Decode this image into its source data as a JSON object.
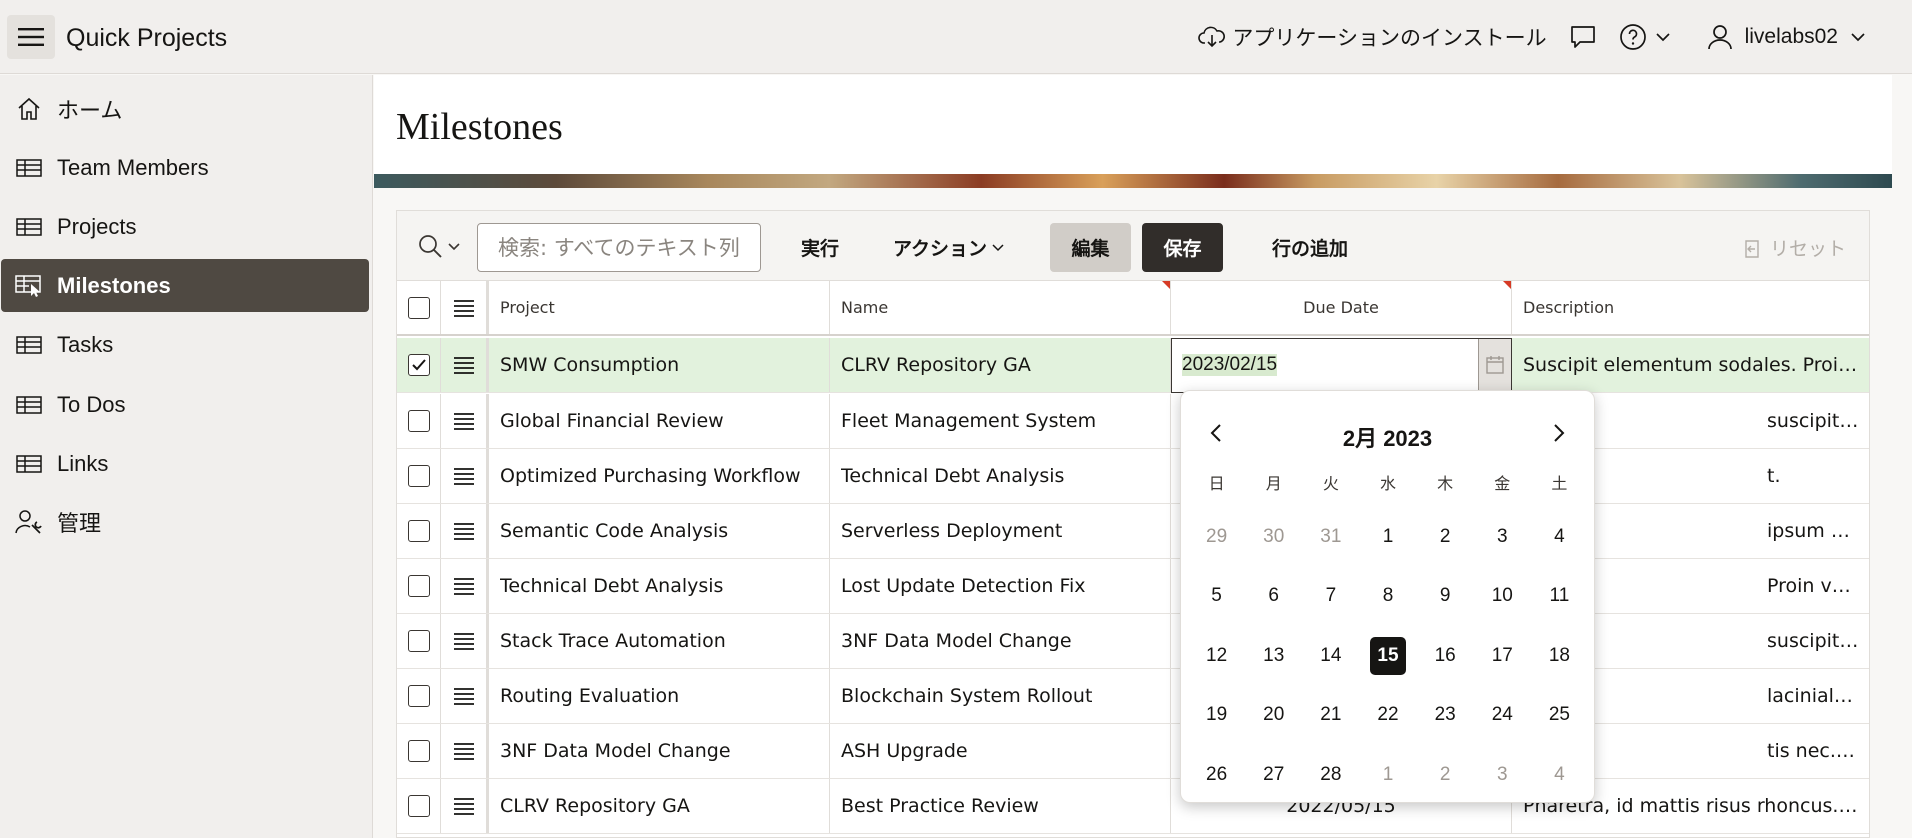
{
  "app": {
    "title": "Quick Projects"
  },
  "header": {
    "install_label": "アプリケーションのインストール",
    "user_name": "livelabs02"
  },
  "sidebar": {
    "items": [
      {
        "label": "ホーム",
        "icon": "home-icon"
      },
      {
        "label": "Team Members",
        "icon": "table-icon"
      },
      {
        "label": "Projects",
        "icon": "table-icon"
      },
      {
        "label": "Milestones",
        "icon": "table-pointer-icon",
        "active": true
      },
      {
        "label": "Tasks",
        "icon": "table-icon"
      },
      {
        "label": "To Dos",
        "icon": "table-icon"
      },
      {
        "label": "Links",
        "icon": "table-icon"
      },
      {
        "label": "管理",
        "icon": "user-wrench-icon"
      }
    ]
  },
  "page": {
    "title": "Milestones"
  },
  "toolbar": {
    "search_placeholder": "検索: すべてのテキスト列",
    "run_label": "実行",
    "actions_label": "アクション",
    "edit_label": "編集",
    "save_label": "保存",
    "add_row_label": "行の追加",
    "reset_label": "リセット"
  },
  "grid": {
    "columns": {
      "project": "Project",
      "name": "Name",
      "due_date": "Due Date",
      "description": "Description"
    },
    "rows": [
      {
        "project": "SMW Consumption",
        "name": "CLRV Repository GA",
        "due": "2023/02/15",
        "description": "Suscipit elementum sodales. Proin s…",
        "selected": true
      },
      {
        "project": "Global Financial Review",
        "name": "Fleet Management System",
        "due": "",
        "description": "suscipit tristique ac volutpat …"
      },
      {
        "project": "Optimized Purchasing Workflow",
        "name": "Technical Debt Analysis",
        "due": "",
        "description": "t."
      },
      {
        "project": "Semantic Code Analysis",
        "name": "Serverless Deployment",
        "due": "",
        "description": "ipsum primis in faucibus. U…"
      },
      {
        "project": "Technical Debt Analysis",
        "name": "Lost Update Detection Fix",
        "due": "",
        "description": "Proin vulputate placerat pell…"
      },
      {
        "project": "Stack Trace Automation",
        "name": "3NF Data Model Change",
        "due": "",
        "description": "suscipit tristique ac volutpat …"
      },
      {
        "project": "Routing Evaluation",
        "name": "Blockchain System Rollout",
        "due": "",
        "description": "lacinialectus, quis consectet…"
      },
      {
        "project": "3NF Data Model Change",
        "name": "ASH Upgrade",
        "due": "",
        "description": "tis nec. Donec convallis solli…"
      },
      {
        "project": "CLRV Repository GA",
        "name": "Best Practice Review",
        "due": "2022/05/15",
        "description": "Pharetra, id mattis risus rhoncus.Cr…"
      }
    ]
  },
  "datepicker": {
    "title": "2月 2023",
    "weekdays": [
      "日",
      "月",
      "火",
      "水",
      "木",
      "金",
      "土"
    ],
    "weeks": [
      [
        "29",
        "30",
        "31",
        "1",
        "2",
        "3",
        "4"
      ],
      [
        "5",
        "6",
        "7",
        "8",
        "9",
        "10",
        "11"
      ],
      [
        "12",
        "13",
        "14",
        "15",
        "16",
        "17",
        "18"
      ],
      [
        "19",
        "20",
        "21",
        "22",
        "23",
        "24",
        "25"
      ],
      [
        "26",
        "27",
        "28",
        "1",
        "2",
        "3",
        "4"
      ]
    ],
    "selected_day": "15"
  }
}
